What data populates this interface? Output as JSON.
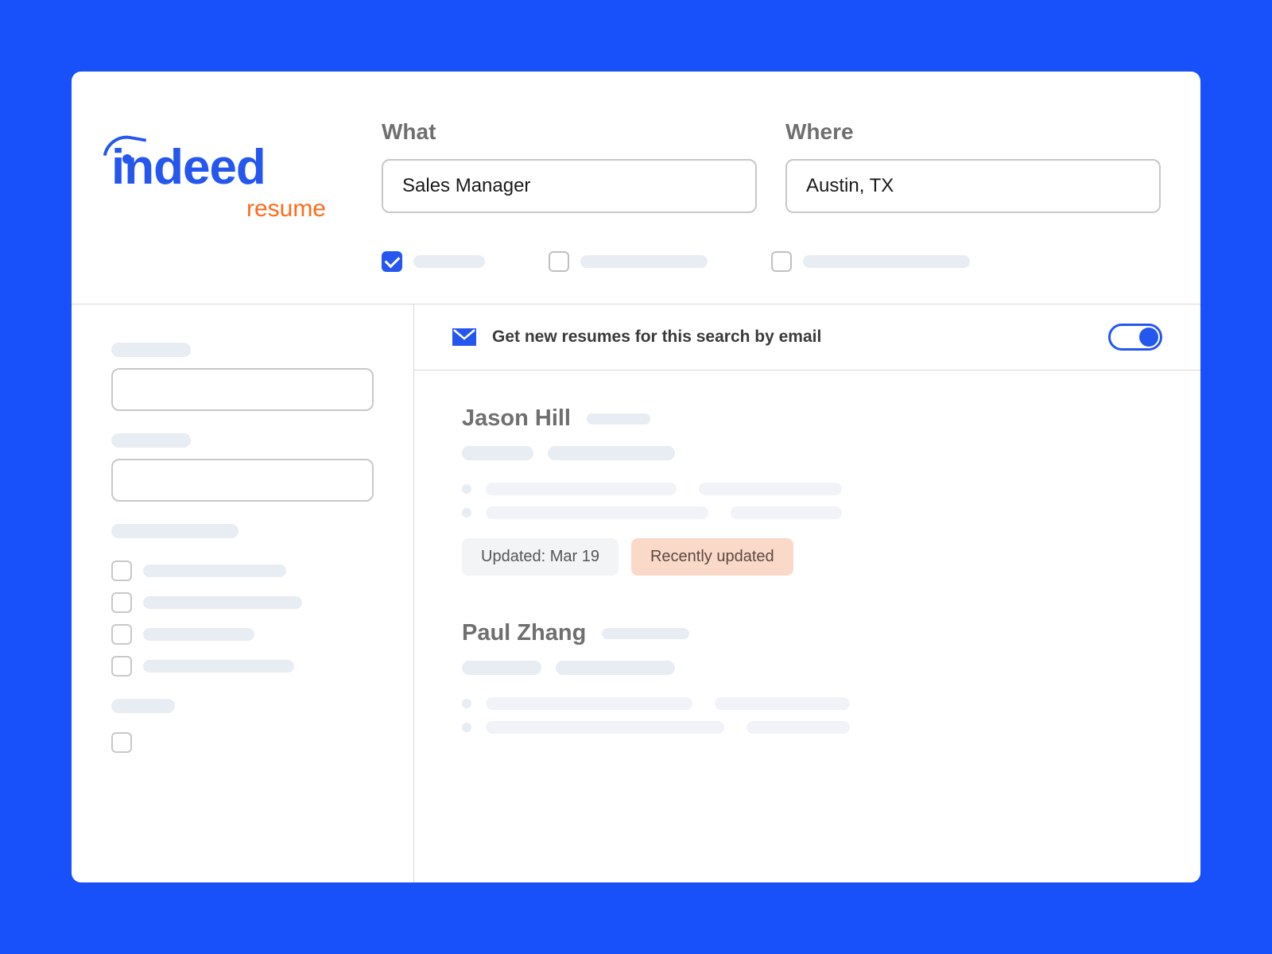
{
  "logo": {
    "main": "indeed",
    "sub": "resume"
  },
  "search": {
    "what_label": "What",
    "what_value": "Sales Manager",
    "where_label": "Where",
    "where_value": "Austin, TX"
  },
  "filters": [
    {
      "checked": true
    },
    {
      "checked": false
    },
    {
      "checked": false
    }
  ],
  "alert": {
    "text": "Get new resumes for this search by email",
    "toggle_on": true
  },
  "candidates": [
    {
      "name": "Jason Hill",
      "updated_label": "Updated: Mar 19",
      "recent_label": "Recently updated"
    },
    {
      "name": "Paul Zhang"
    }
  ]
}
